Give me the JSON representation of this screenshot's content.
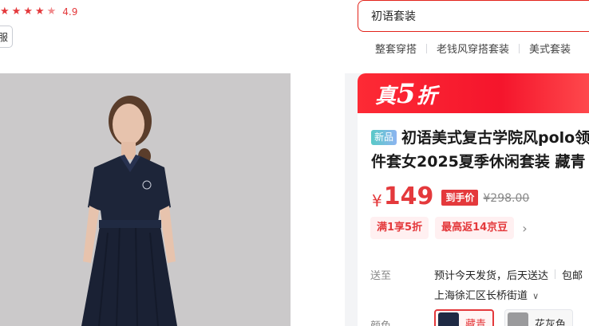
{
  "rating": {
    "value": "4.9",
    "stars": 5
  },
  "shop": {
    "button_label": "服"
  },
  "search": {
    "value": "初语套装"
  },
  "hotwords": [
    "整套穿搭",
    "老钱风穿搭套装",
    "美式套装"
  ],
  "promo": {
    "prefix": "真",
    "number": "5",
    "suffix": "折"
  },
  "product": {
    "new_tag": "新品",
    "title_line1": "初语美式复古学院风polo领",
    "title_line2": "件套女2025夏季休闲套装 藏青"
  },
  "price": {
    "symbol": "¥",
    "value": "149",
    "tag": "到手价",
    "original": "¥298.00"
  },
  "coupons": [
    "满1享5折",
    "最高返14京豆"
  ],
  "shipping": {
    "label": "送至",
    "line1_a": "预计今天发货，后天送达",
    "line1_b": "包邮",
    "address": "上海徐汇区长桥街道"
  },
  "color": {
    "label": "颜色",
    "options": [
      {
        "name": "藏青",
        "selected": true,
        "swatch": "#1f2a44"
      },
      {
        "name": "花灰色",
        "selected": false,
        "swatch": "#9a9a9c"
      }
    ]
  },
  "colors": {
    "accent": "#e4393c",
    "promo_bg": "#fd2a35"
  }
}
